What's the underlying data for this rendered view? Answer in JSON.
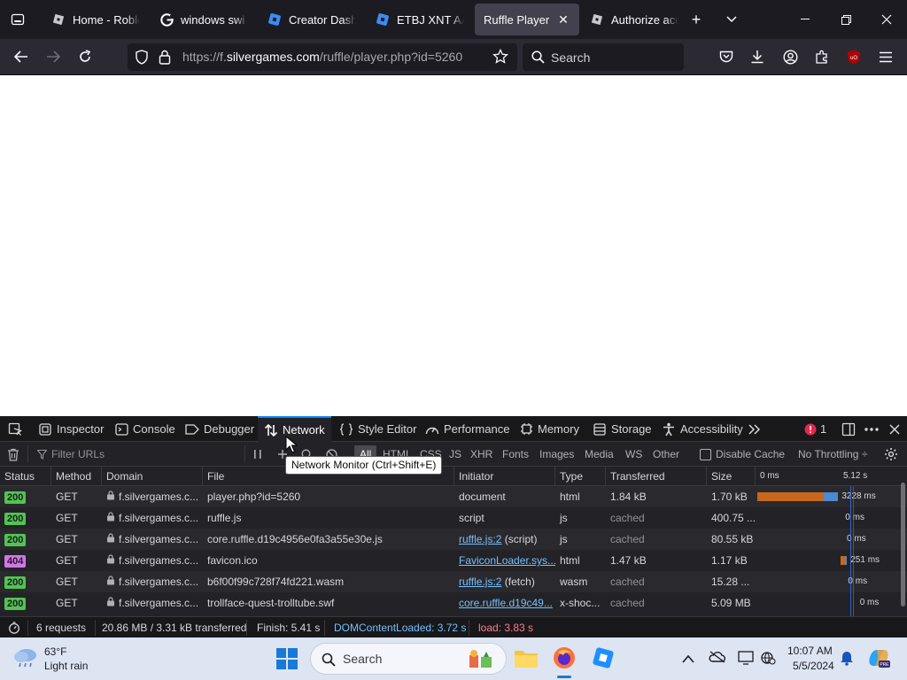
{
  "browser": {
    "tabs": [
      {
        "title": "Home - Roblo",
        "icon": "roblox-icon",
        "active": false
      },
      {
        "title": "windows swi",
        "icon": "google-icon",
        "active": false
      },
      {
        "title": "Creator Dashb",
        "icon": "roblox-studio-icon",
        "active": false
      },
      {
        "title": "ETBJ XNT AAR",
        "icon": "roblox-studio-icon",
        "active": false
      },
      {
        "title": "Ruffle Player",
        "icon": "",
        "active": true
      },
      {
        "title": "Authorize acc",
        "icon": "roblox-icon",
        "active": false
      }
    ],
    "url_prefix": "https://f.",
    "url_domain": "silvergames.com",
    "url_path": "/ruffle/player.php?id=5260",
    "search_placeholder": "Search"
  },
  "devtools": {
    "tabs": [
      {
        "label": "Inspector",
        "icon": "inspector-icon"
      },
      {
        "label": "Console",
        "icon": "console-icon"
      },
      {
        "label": "Debugger",
        "icon": "debugger-icon"
      },
      {
        "label": "Network",
        "icon": "network-icon",
        "active": true
      },
      {
        "label": "Style Editor",
        "icon": "braces-icon"
      },
      {
        "label": "Performance",
        "icon": "performance-icon"
      },
      {
        "label": "Memory",
        "icon": "memory-icon"
      },
      {
        "label": "Storage",
        "icon": "storage-icon"
      },
      {
        "label": "Accessibility",
        "icon": "accessibility-icon"
      }
    ],
    "error_count": "1",
    "toolbar": {
      "filter_placeholder": "Filter URLs",
      "type_filters": [
        "All",
        "HTML",
        "CSS",
        "JS",
        "XHR",
        "Fonts",
        "Images",
        "Media",
        "WS",
        "Other"
      ],
      "active_filter": "All",
      "disable_cache": "Disable Cache",
      "throttling": "No Throttling ÷"
    },
    "tooltip": "Network Monitor (Ctrl+Shift+E)",
    "columns": [
      "Status",
      "Method",
      "Domain",
      "File",
      "Initiator",
      "Type",
      "Transferred",
      "Size"
    ],
    "waterfall_ticks": [
      "0 ms",
      "5.12 s"
    ],
    "requests": [
      {
        "status": "200",
        "method": "GET",
        "domain": "f.silvergames.c...",
        "file": "player.php?id=5260",
        "initiator": "document",
        "initiator_link": "",
        "type": "html",
        "transferred": "1.84 kB",
        "size": "1.70 kB",
        "timing": "3228 ms",
        "start_s": 0.0,
        "duration_s": 3.23
      },
      {
        "status": "200",
        "method": "GET",
        "domain": "f.silvergames.c...",
        "file": "ruffle.js",
        "initiator": "script",
        "initiator_link": "",
        "type": "js",
        "transferred": "cached",
        "size": "400.75 ...",
        "timing": "0 ms",
        "start_s": 3.37,
        "duration_s": 0.0
      },
      {
        "status": "200",
        "method": "GET",
        "domain": "f.silvergames.c...",
        "file": "core.ruffle.d19c4956e0fa3a55e30e.js",
        "initiator": " (script)",
        "initiator_link": "ruffle.js:2",
        "type": "js",
        "transferred": "cached",
        "size": "80.55 kB",
        "timing": "0 ms",
        "start_s": 3.43,
        "duration_s": 0.0
      },
      {
        "status": "404",
        "method": "GET",
        "domain": "f.silvergames.c...",
        "file": "favicon.ico",
        "initiator": "",
        "initiator_link": "FaviconLoader.sys...",
        "type": "html",
        "transferred": "1.47 kB",
        "size": "1.17 kB",
        "timing": "251 ms",
        "start_s": 3.33,
        "duration_s": 0.25
      },
      {
        "status": "200",
        "method": "GET",
        "domain": "f.silvergames.c...",
        "file": "b6f00f99c728f74fd221.wasm",
        "initiator": " (fetch)",
        "initiator_link": "ruffle.js:2",
        "type": "wasm",
        "transferred": "cached",
        "size": "15.28 ...",
        "timing": "0 ms",
        "start_s": 3.48,
        "duration_s": 0.0
      },
      {
        "status": "200",
        "method": "GET",
        "domain": "f.silvergames.c...",
        "file": "trollface-quest-trolltube.swf",
        "initiator": "",
        "initiator_link": "core.ruffle.d19c49...",
        "type": "x-shoc...",
        "transferred": "cached",
        "size": "5.09 MB",
        "timing": "0 ms",
        "start_s": 3.95,
        "duration_s": 0.0
      }
    ],
    "summary": {
      "requests": "6 requests",
      "transferred": "20.86 MB / 3.31 kB transferred",
      "finish": "Finish: 5.41 s",
      "domcontentloaded": "DOMContentLoaded: 3.72 s",
      "load": "load: 3.83 s"
    },
    "colors": {
      "status_ok": "#51c451",
      "status_error": "#d475e7",
      "wait_bar": "#c7671b",
      "receive_bar": "#4c8ad2",
      "domcontentloaded_line": "#2e7cff",
      "load_line": "#e22850"
    }
  },
  "taskbar": {
    "weather_temp": "63°F",
    "weather_desc": "Light rain",
    "search_label": "Search",
    "time": "10:07 AM",
    "date": "5/5/2024"
  }
}
